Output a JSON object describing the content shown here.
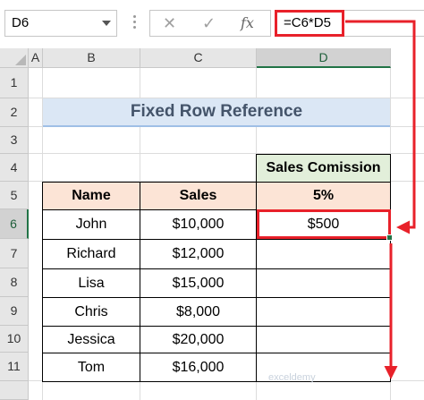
{
  "name_box": "D6",
  "formula_bar": {
    "cancel_icon": "✕",
    "enter_icon": "✓",
    "fx_label": "fx",
    "formula": "=C6*D5"
  },
  "columns": [
    "A",
    "B",
    "C",
    "D"
  ],
  "selected_column": "D",
  "rows": [
    "1",
    "2",
    "3",
    "4",
    "5",
    "6",
    "7",
    "8",
    "9",
    "10",
    "11"
  ],
  "selected_row": "6",
  "title": "Fixed Row Reference",
  "commission_header": "Sales Comission",
  "table": {
    "headers": [
      "Name",
      "Sales",
      "5%"
    ],
    "rows": [
      [
        "John",
        "$10,000",
        "$500"
      ],
      [
        "Richard",
        "$12,000",
        ""
      ],
      [
        "Lisa",
        "$15,000",
        ""
      ],
      [
        "Chris",
        "$8,000",
        ""
      ],
      [
        "Jessica",
        "$20,000",
        ""
      ],
      [
        "Tom",
        "$16,000",
        ""
      ]
    ]
  },
  "colors": {
    "highlight": "#e8212a",
    "header_fill": "#fce4d6",
    "commission_fill": "#e2efda",
    "title_fill": "#dbe7f5",
    "excel_green": "#217346"
  },
  "watermark": "exceldemy"
}
